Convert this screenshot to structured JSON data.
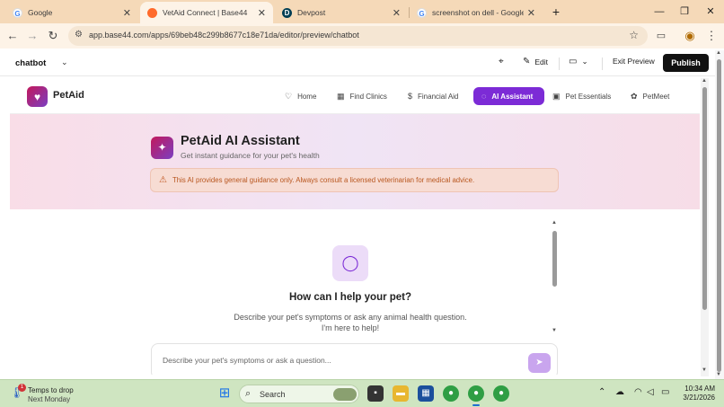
{
  "browser": {
    "tabs": [
      {
        "title": "Google",
        "icon": "google-icon",
        "active": false
      },
      {
        "title": "VetAid Connect | Base44",
        "icon": "base44-icon",
        "active": true
      },
      {
        "title": "Devpost",
        "icon": "devpost-icon",
        "active": false
      },
      {
        "title": "screenshot on dell - Google Se",
        "icon": "google-icon",
        "active": false
      }
    ],
    "new_tab": "+",
    "window_controls": {
      "minimize": "—",
      "maximize": "❐",
      "close": "✕"
    },
    "url": "app.base44.com/apps/69beb48c299b8677c18e71da/editor/preview/chatbot"
  },
  "editor": {
    "page_name": "chatbot",
    "edit_label": "Edit",
    "exit_preview_label": "Exit Preview",
    "publish_label": "Publish"
  },
  "app": {
    "brand": "PetAid",
    "nav": [
      {
        "label": "Home",
        "icon": "heart-icon",
        "active": false
      },
      {
        "label": "Find Clinics",
        "icon": "map-icon",
        "active": false
      },
      {
        "label": "Financial Aid",
        "icon": "dollar-icon",
        "active": false
      },
      {
        "label": "AI Assistant",
        "icon": "chat-icon",
        "active": true
      },
      {
        "label": "Pet Essentials",
        "icon": "bag-icon",
        "active": false
      },
      {
        "label": "PetMeet",
        "icon": "paw-icon",
        "active": false
      }
    ],
    "hero": {
      "title": "PetAid AI Assistant",
      "subtitle": "Get instant guidance for your pet's health",
      "notice": "This AI provides general guidance only. Always consult a licensed veterinarian for medical advice."
    },
    "chat": {
      "heading": "How can I help your pet?",
      "description_line1": "Describe your pet's symptoms or ask any animal health question.",
      "description_line2": "I'm here to help!",
      "input_value": "",
      "input_placeholder": "Describe your pet's symptoms or ask a question..."
    }
  },
  "taskbar": {
    "weather_line1": "Temps to drop",
    "weather_line2": "Next Monday",
    "weather_badge": "1",
    "search_label": "Search",
    "time": "10:34 AM",
    "date": "3/21/2026"
  },
  "colors": {
    "accent": "#7c2bd6",
    "brand_gradient_start": "#c2185b",
    "brand_gradient_end": "#7b3fc2",
    "notice_text": "#b8561e",
    "tabstrip": "#f5d9b8",
    "taskbar": "#cfe5c1"
  }
}
